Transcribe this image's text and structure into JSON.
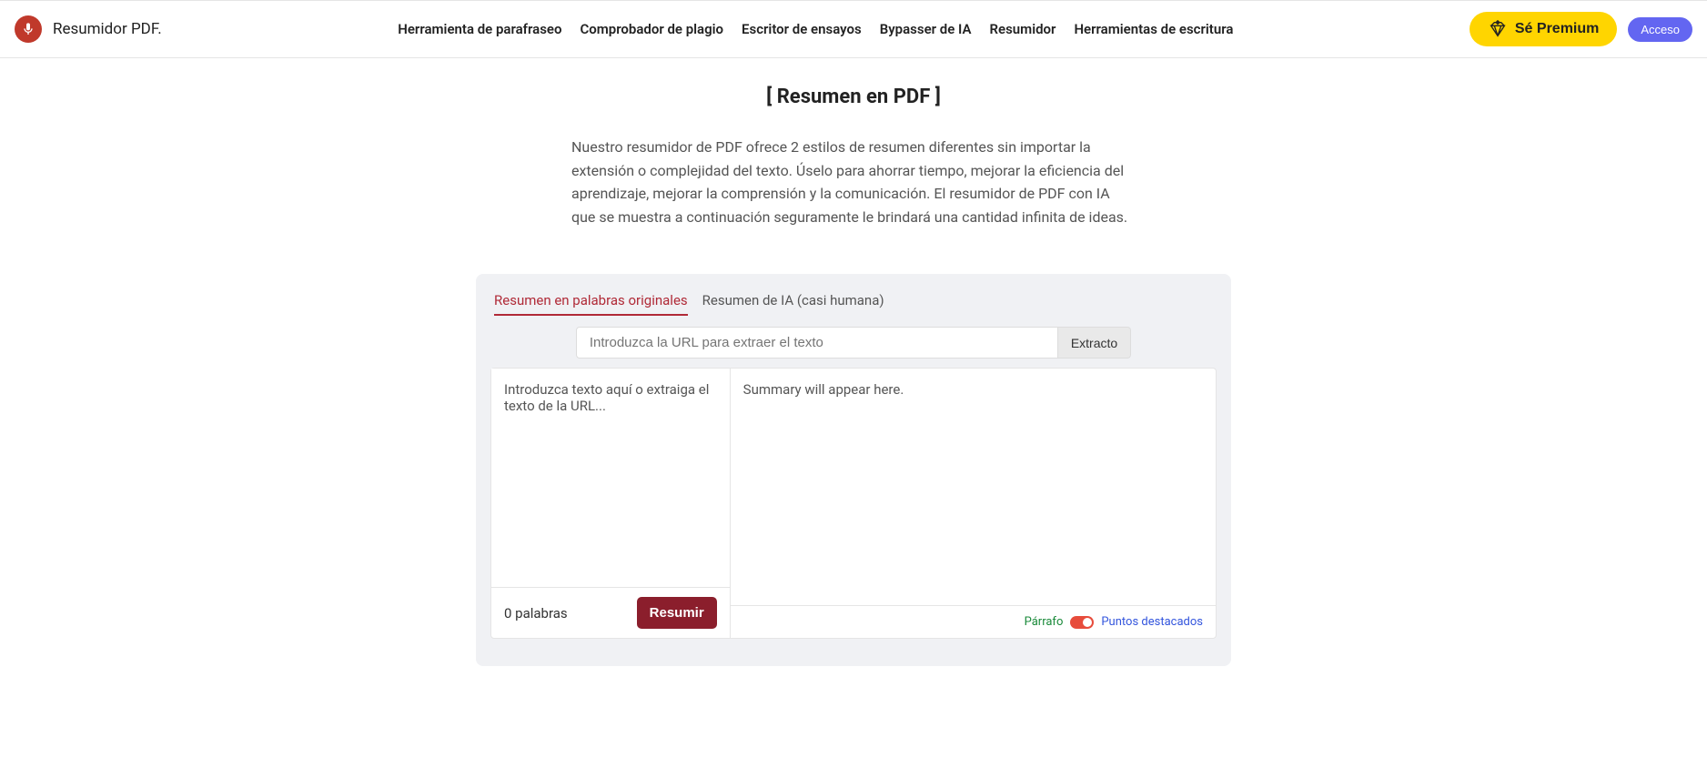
{
  "header": {
    "brand": "Resumidor PDF.",
    "nav": [
      "Herramienta de parafraseo",
      "Comprobador de plagio",
      "Escritor de ensayos",
      "Bypasser de IA",
      "Resumidor",
      "Herramientas de escritura"
    ],
    "premium": "Sé Premium",
    "access": "Acceso"
  },
  "title": "[ Resumen en PDF ]",
  "description": "Nuestro resumidor de PDF ofrece 2 estilos de resumen diferentes sin importar la extensión o complejidad del texto. Úselo para ahorrar tiempo, mejorar la eficiencia del aprendizaje, mejorar la comprensión y la comunicación. El resumidor de PDF con IA que se muestra a continuación seguramente le brindará una cantidad infinita de ideas.",
  "tabs": {
    "original": "Resumen en palabras originales",
    "ai": "Resumen de IA (casi humana)"
  },
  "url": {
    "placeholder": "Introduzca la URL para extraer el texto",
    "extract": "Extracto"
  },
  "input": {
    "placeholder": "Introduzca texto aquí o extraiga el texto de la URL..."
  },
  "output": {
    "placeholder": "Summary will appear here."
  },
  "footer": {
    "wordCount": "0 palabras",
    "summarize": "Resumir",
    "parrafo": "Párrafo",
    "puntos": "Puntos destacados"
  }
}
